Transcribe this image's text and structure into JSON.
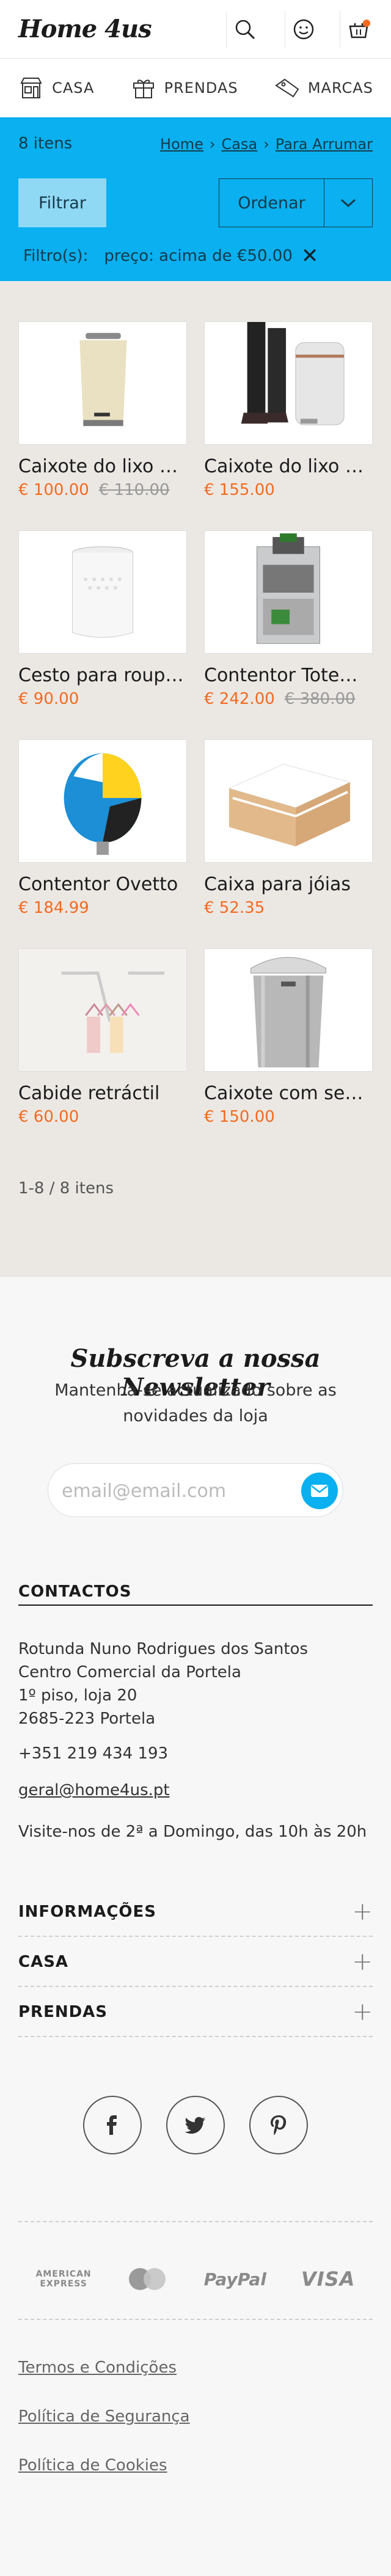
{
  "header": {
    "logo": "Home 4us",
    "icons": [
      "search-icon",
      "account-icon",
      "cart-icon"
    ]
  },
  "catnav": [
    {
      "label": "CASA",
      "icon": "store-icon"
    },
    {
      "label": "PRENDAS",
      "icon": "gift-icon"
    },
    {
      "label": "MARCAS",
      "icon": "tag-icon"
    }
  ],
  "listing": {
    "count": "8 itens",
    "breadcrumb": [
      "Home",
      "Casa",
      "Para Arrumar"
    ],
    "filter_button": "Filtrar",
    "order_button": "Ordenar",
    "filters_label": "Filtro(s):",
    "active_filter": "preço: acima de €50.00",
    "pagination": "1-8 / 8 itens"
  },
  "products": [
    {
      "name": "Caixote do lixo N...",
      "price": "€ 100.00",
      "old_price": "€ 110.00"
    },
    {
      "name": "Caixote do lixo c...",
      "price": "€ 155.00",
      "old_price": ""
    },
    {
      "name": "Cesto para roupa ...",
      "price": "€ 90.00",
      "old_price": ""
    },
    {
      "name": "Contentor Totem ...",
      "price": "€ 242.00",
      "old_price": "€ 380.00"
    },
    {
      "name": "Contentor Ovetto",
      "price": "€ 184.99",
      "old_price": ""
    },
    {
      "name": "Caixa para jóias",
      "price": "€ 52.35",
      "old_price": ""
    },
    {
      "name": "Cabide retráctil",
      "price": "€ 60.00",
      "old_price": ""
    },
    {
      "name": "Caixote com sens...",
      "price": "€ 150.00",
      "old_price": ""
    }
  ],
  "newsletter": {
    "title": "Subscreva a nossa Newsletter",
    "subtitle": "Mantenha-se actualizado sobre as novidades da loja",
    "placeholder": "email@email.com"
  },
  "contacts": {
    "heading": "CONTACTOS",
    "address_lines": [
      "Rotunda Nuno Rodrigues dos Santos",
      "Centro Comercial da Portela",
      "1º piso, loja 20",
      "2685-223 Portela"
    ],
    "phone": "+351 219 434 193",
    "email": "geral@home4us.pt",
    "hours": "Visite-nos de 2ª a Domingo, das 10h às 20h"
  },
  "accordions": [
    "INFORMAÇÕES",
    "CASA",
    "PRENDAS"
  ],
  "social": [
    "facebook-icon",
    "twitter-icon",
    "pinterest-icon"
  ],
  "payments": {
    "amex_line1": "AMERICAN",
    "amex_line2": "EXPRESS",
    "paypal": "PayPal",
    "visa": "VISA"
  },
  "legal_links": [
    "Termos e Condições",
    "Política de Segurança",
    "Política de Cookies"
  ],
  "colors": {
    "accent_blue": "#0ab0ef",
    "price_orange": "#f46a1e",
    "products_bg": "#ebe8e4"
  }
}
